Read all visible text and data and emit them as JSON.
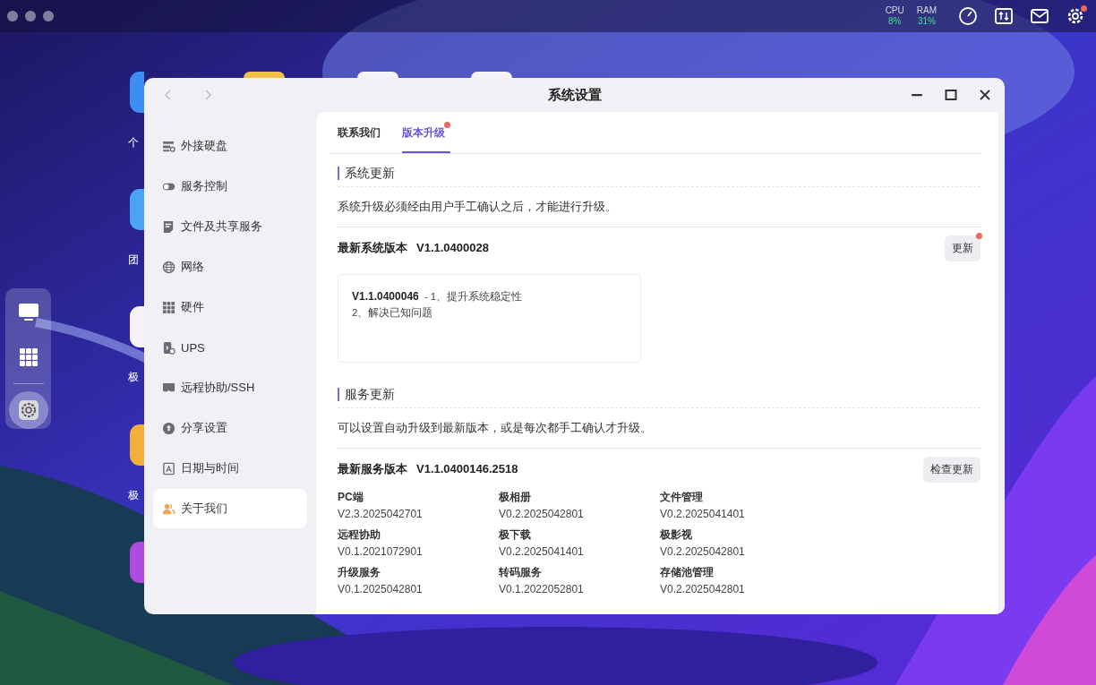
{
  "menu_bar": {
    "cpu": {
      "label": "CPU",
      "value": "8%"
    },
    "ram": {
      "label": "RAM",
      "value": "31%"
    },
    "settings_badge": true
  },
  "desktop_icons": [
    {
      "label": "个",
      "color": "#3d8ef2"
    },
    {
      "label": "团",
      "color": "#4aa3f5"
    },
    {
      "label": "极",
      "color": "#f7f2f5"
    },
    {
      "label": "极",
      "color": "#f2b03a"
    },
    {
      "color": "#b04be0"
    },
    {
      "color": "#f0c24a"
    },
    {
      "color": "#f4f4f8"
    },
    {
      "color": "#f4f4f8"
    }
  ],
  "dock": {
    "items": [
      {
        "kind": "desktop",
        "selected": false
      },
      {
        "kind": "apps",
        "selected": false
      },
      {
        "kind": "settings",
        "selected": true
      }
    ]
  },
  "window": {
    "title": "系统设置",
    "sidebar": [
      {
        "label": "外接硬盘",
        "kind": "disk",
        "selected": false
      },
      {
        "label": "服务控制",
        "kind": "toggle",
        "selected": false
      },
      {
        "label": "文件及共享服务",
        "kind": "document",
        "selected": false
      },
      {
        "label": "网络",
        "kind": "globe",
        "selected": false
      },
      {
        "label": "硬件",
        "kind": "grid",
        "selected": false
      },
      {
        "label": "UPS",
        "kind": "ups",
        "selected": false
      },
      {
        "label": "远程协助/SSH",
        "kind": "monitor",
        "selected": false
      },
      {
        "label": "分享设置",
        "kind": "share",
        "selected": false
      },
      {
        "label": "日期与时间",
        "kind": "calendar",
        "selected": false
      },
      {
        "label": "关于我们",
        "kind": "people",
        "selected": true
      }
    ],
    "tabs": [
      {
        "label": "联系我们",
        "selected": false,
        "badge": false
      },
      {
        "label": "版本升级",
        "selected": true,
        "badge": true
      }
    ],
    "system_update": {
      "title": "系统更新",
      "description": "系统升级必须经由用户手工确认之后，才能进行升级。",
      "latest_label": "最新系统版本",
      "latest_version": "V1.1.0400028",
      "button": {
        "label": "更新",
        "badge": true
      },
      "release_notes": {
        "version": "V1.1.0400046",
        "lines": [
          "- 1、提升系统稳定性",
          "2、解决已知问题"
        ]
      }
    },
    "service_update": {
      "title": "服务更新",
      "description": "可以设置自动升级到最新版本，或是每次都手工确认才升级。",
      "latest_label": "最新服务版本",
      "latest_version": "V1.1.0400146.2518",
      "button": {
        "label": "检查更新"
      },
      "services": [
        {
          "name": "PC端",
          "version": "V2.3.2025042701"
        },
        {
          "name": "极相册",
          "version": "V0.2.2025042801"
        },
        {
          "name": "文件管理",
          "version": "V0.2.2025041401"
        },
        {
          "name": "远程协助",
          "version": "V0.1.2021072901"
        },
        {
          "name": "极下载",
          "version": "V0.2.2025041401"
        },
        {
          "name": "极影视",
          "version": "V0.2.2025042801"
        },
        {
          "name": "升级服务",
          "version": "V0.1.2025042801"
        },
        {
          "name": "转码服务",
          "version": "V0.1.2022052801"
        },
        {
          "name": "存储池管理",
          "version": "V0.2.2025042801"
        }
      ]
    }
  }
}
